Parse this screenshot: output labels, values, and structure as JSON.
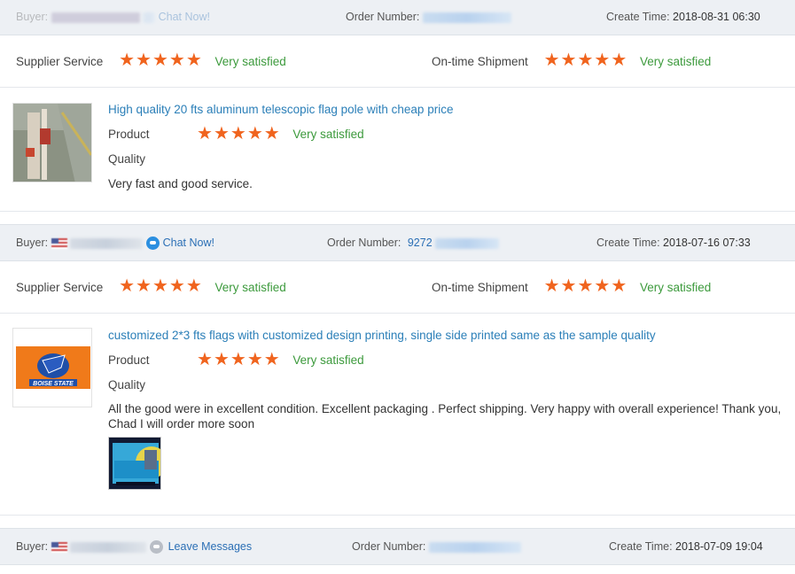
{
  "labels": {
    "buyer": "Buyer:",
    "order_number": "Order Number:",
    "create_time": "Create Time:",
    "supplier_service": "Supplier Service",
    "ontime_shipment": "On-time Shipment",
    "product": "Product",
    "quality": "Quality"
  },
  "star_icon": "★",
  "colors": {
    "star": "#f0641e",
    "satisfied": "#3c9a3c",
    "link": "#2b7fb8",
    "header_bg": "#edf0f4"
  },
  "orders": [
    {
      "buyer_action": "Chat Now!",
      "create_time": "2018-08-31 06:30",
      "supplier_service": {
        "stars": 5,
        "text": "Very satisfied"
      },
      "ontime_shipment": {
        "stars": 5,
        "text": "Very satisfied"
      },
      "product_title": "High quality 20 fts aluminum telescopic flag pole with cheap price",
      "product_rating": {
        "stars": 5,
        "text": "Very satisfied"
      },
      "review": "Very fast and good service."
    },
    {
      "buyer_action": "Chat Now!",
      "order_number_partial": "9272",
      "create_time": "2018-07-16 07:33",
      "supplier_service": {
        "stars": 5,
        "text": "Very satisfied"
      },
      "ontime_shipment": {
        "stars": 5,
        "text": "Very satisfied"
      },
      "product_title": "customized 2*3 fts flags with customized design printing, single side printed same as the sample quality",
      "product_image_text": "BOISE STATE",
      "product_rating": {
        "stars": 5,
        "text": "Very satisfied"
      },
      "review": "All the good were in excellent condition. Excellent packaging . Perfect shipping. Very happy with overall experience! Thank you, Chad I will order more soon"
    },
    {
      "buyer_action": "Leave Messages",
      "create_time": "2018-07-09 19:04"
    }
  ]
}
